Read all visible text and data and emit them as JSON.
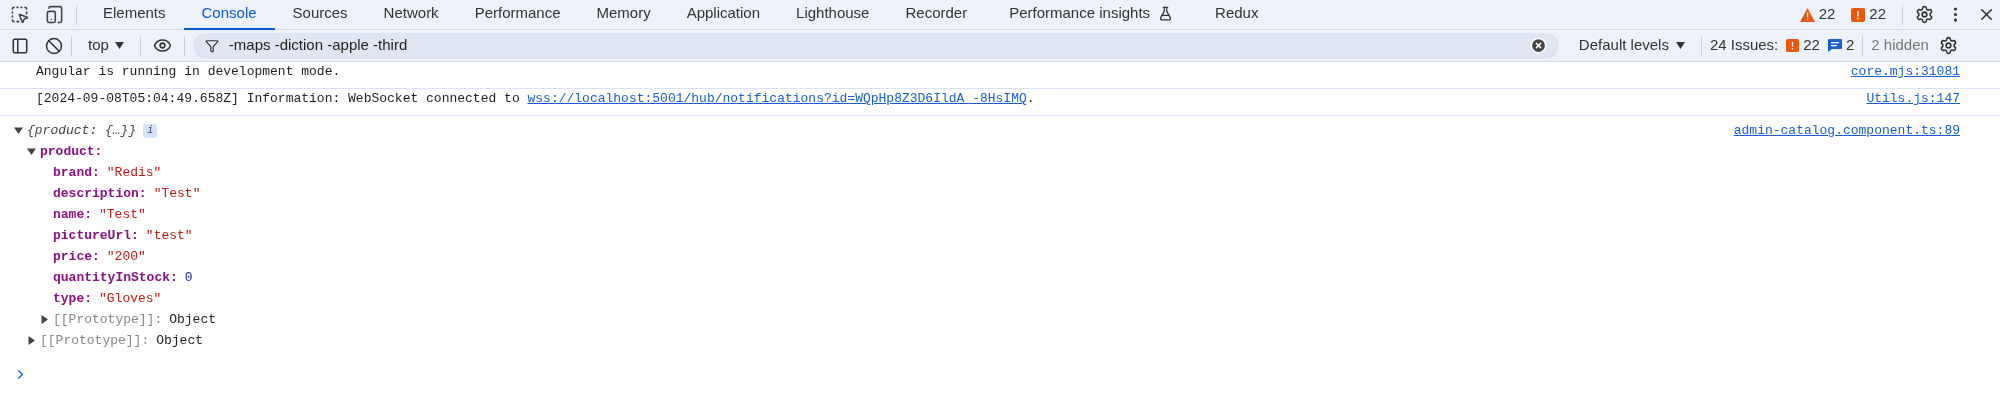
{
  "tabs": [
    {
      "label": "Elements",
      "selected": false,
      "experimental": false
    },
    {
      "label": "Console",
      "selected": true,
      "experimental": false
    },
    {
      "label": "Sources",
      "selected": false,
      "experimental": false
    },
    {
      "label": "Network",
      "selected": false,
      "experimental": false
    },
    {
      "label": "Performance",
      "selected": false,
      "experimental": false
    },
    {
      "label": "Memory",
      "selected": false,
      "experimental": false
    },
    {
      "label": "Application",
      "selected": false,
      "experimental": false
    },
    {
      "label": "Lighthouse",
      "selected": false,
      "experimental": false
    },
    {
      "label": "Recorder",
      "selected": false,
      "experimental": false
    },
    {
      "label": "Performance insights",
      "selected": false,
      "experimental": true
    },
    {
      "label": "Redux",
      "selected": false,
      "experimental": false
    }
  ],
  "status": {
    "warnings": "22",
    "errors": "22"
  },
  "toolbar": {
    "context": "top",
    "filter": "-maps -diction -apple -third",
    "levels": "Default levels",
    "issues_label": "24 Issues:",
    "issue_errors": "22",
    "issue_info": "2",
    "hidden": "2 hidden"
  },
  "messages": [
    {
      "kind": "text",
      "text": "Angular is running in development mode.",
      "source": "core.mjs:31081"
    },
    {
      "kind": "link",
      "text": "[2024-09-08T05:04:49.658Z] Information: WebSocket connected to ",
      "link": "wss://localhost:5001/hub/notifications?id=WQpHp8Z3D6IldA_-8HsIMQ",
      "suffix": ".",
      "source": "Utils.js:147"
    },
    {
      "kind": "object",
      "summary": "{product: {…}}",
      "badge": "i",
      "expanded": true,
      "source": "admin-catalog.component.ts:89",
      "children": [
        {
          "kind": "group",
          "key": "product:",
          "expanded": true,
          "children": [
            {
              "kind": "string",
              "key": "brand:",
              "value": "\"Redis\""
            },
            {
              "kind": "string",
              "key": "description:",
              "value": "\"Test\""
            },
            {
              "kind": "string",
              "key": "name:",
              "value": "\"Test\""
            },
            {
              "kind": "string",
              "key": "pictureUrl:",
              "value": "\"test\""
            },
            {
              "kind": "string",
              "key": "price:",
              "value": "\"200\""
            },
            {
              "kind": "number",
              "key": "quantityInStock:",
              "value": "0"
            },
            {
              "kind": "string",
              "key": "type:",
              "value": "\"Gloves\""
            },
            {
              "kind": "prototype",
              "key": "[[Prototype]]:",
              "value": "Object",
              "expanded": false
            }
          ]
        },
        {
          "kind": "prototype",
          "key": "[[Prototype]]:",
          "value": "Object",
          "expanded": false
        }
      ]
    }
  ]
}
